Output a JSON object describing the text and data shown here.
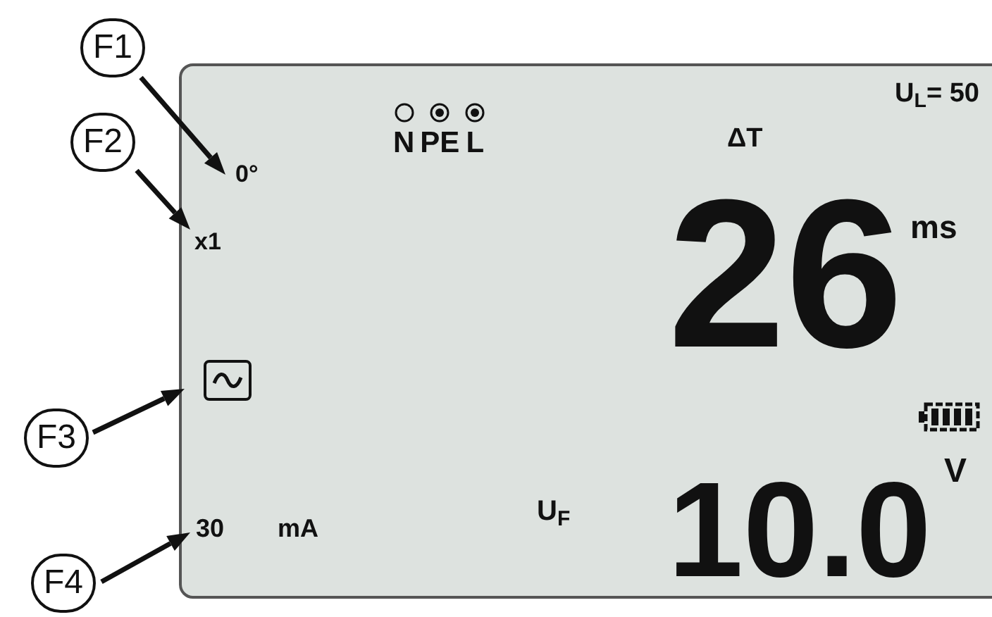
{
  "callouts": [
    {
      "label": "F1"
    },
    {
      "label": "F2"
    },
    {
      "label": "F3"
    },
    {
      "label": "F4"
    }
  ],
  "lcd": {
    "phase": "0°",
    "multiplier": "x1",
    "terminals": [
      {
        "label": "N",
        "active": false
      },
      {
        "label": "PE",
        "active": true
      },
      {
        "label": "L",
        "active": true
      }
    ],
    "limit": "U$_{L}$= 50",
    "delta": "ΔT",
    "time": "26",
    "time_unit": "ms",
    "voltage_label": "U$_{F}$",
    "voltage": "10.0",
    "voltage_unit": "V",
    "current": "30",
    "current_unit": "mA"
  }
}
